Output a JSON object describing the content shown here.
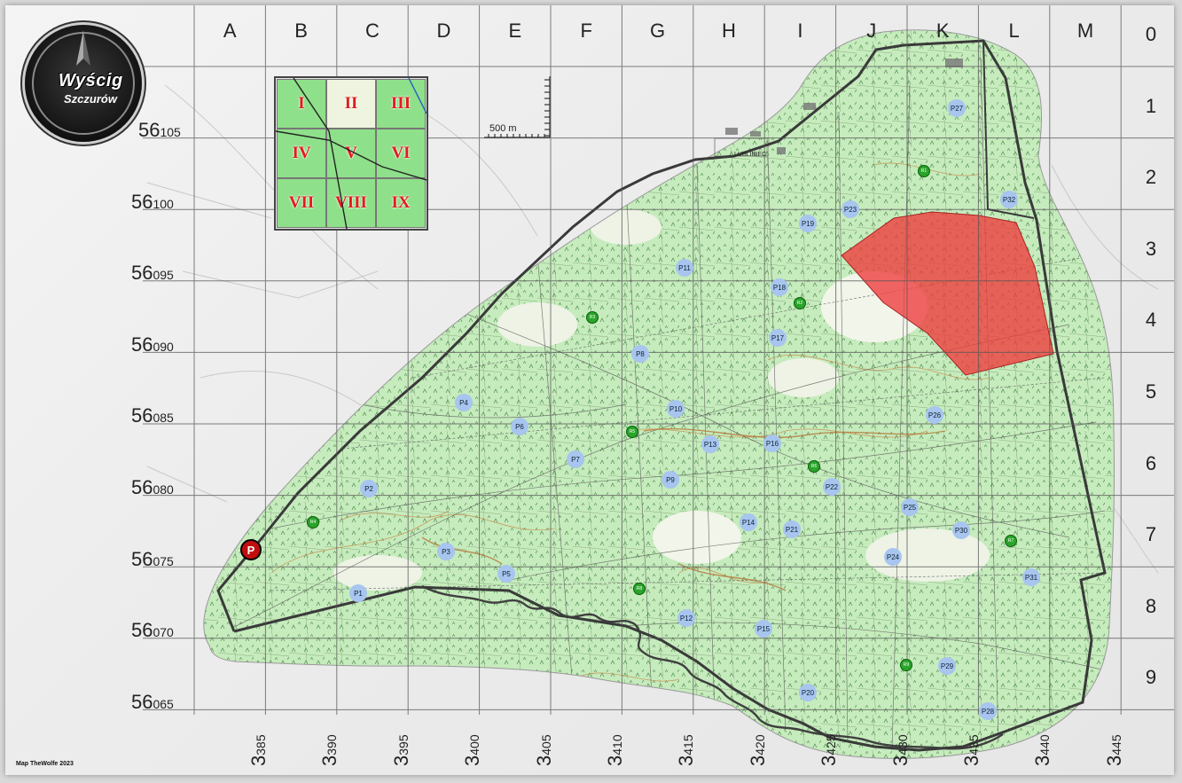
{
  "logo": {
    "line1": "Wyścig",
    "line2": "Szczurów"
  },
  "grid": {
    "columns": [
      "A",
      "B",
      "C",
      "D",
      "E",
      "F",
      "G",
      "H",
      "I",
      "J",
      "K",
      "L",
      "M"
    ],
    "rows": [
      "0",
      "1",
      "2",
      "3",
      "4",
      "5",
      "6",
      "7",
      "8",
      "9"
    ],
    "northing": [
      {
        "big": "56",
        "small": "105"
      },
      {
        "big": "56",
        "small": "100"
      },
      {
        "big": "56",
        "small": "095"
      },
      {
        "big": "56",
        "small": "090"
      },
      {
        "big": "56",
        "small": "085"
      },
      {
        "big": "56",
        "small": "080"
      },
      {
        "big": "56",
        "small": "075"
      },
      {
        "big": "56",
        "small": "070"
      },
      {
        "big": "56",
        "small": "065"
      }
    ],
    "easting": [
      {
        "big": "3",
        "small": "385"
      },
      {
        "big": "3",
        "small": "390"
      },
      {
        "big": "3",
        "small": "395"
      },
      {
        "big": "3",
        "small": "400"
      },
      {
        "big": "3",
        "small": "405"
      },
      {
        "big": "3",
        "small": "410"
      },
      {
        "big": "3",
        "small": "415"
      },
      {
        "big": "3",
        "small": "420"
      },
      {
        "big": "3",
        "small": "425"
      },
      {
        "big": "3",
        "small": "430"
      },
      {
        "big": "3",
        "small": "435"
      },
      {
        "big": "3",
        "small": "440"
      },
      {
        "big": "3",
        "small": "445"
      }
    ]
  },
  "sectors": [
    "I",
    "II",
    "III",
    "IV",
    "V",
    "VI",
    "VII",
    "VIII",
    "IX"
  ],
  "scale_bar": "500 m",
  "town_label": "LUBLINIEC",
  "checkpoints": [
    "P1",
    "P2",
    "P3",
    "P4",
    "P5",
    "P6",
    "P7",
    "P8",
    "P9",
    "P10",
    "P11",
    "P12",
    "P13",
    "P14",
    "P15",
    "P16",
    "P17",
    "P18",
    "P19",
    "P20",
    "P21",
    "P22",
    "P23",
    "P24",
    "P25",
    "P26",
    "P27",
    "P28",
    "P29",
    "P30",
    "P31",
    "P32"
  ],
  "rally_points": [
    "R1",
    "R2",
    "R3",
    "R4",
    "R5",
    "R6",
    "R7",
    "R8",
    "R9"
  ],
  "parking": "P",
  "credit": "Map TheWolfe 2023",
  "colors": {
    "forest": "#c8ecc0",
    "restricted_zone": "#ee3b3b",
    "boundary": "#3a3a3a",
    "river": "#4a4a4a",
    "checkpoint": "#a7c5ee",
    "rally": "#2aa52a"
  }
}
